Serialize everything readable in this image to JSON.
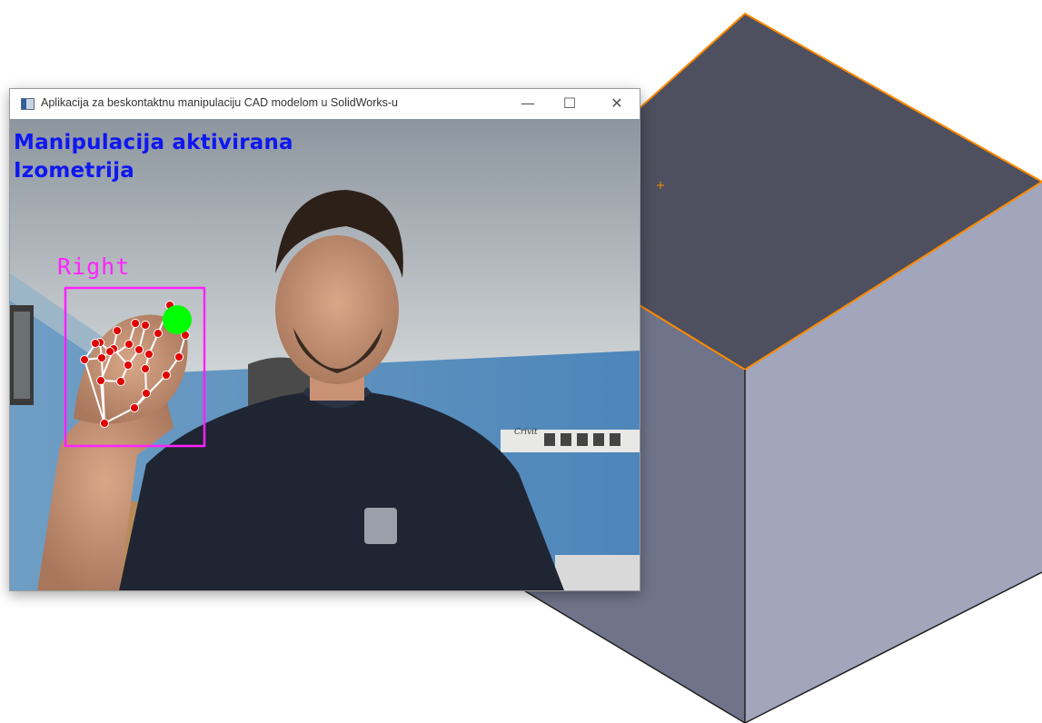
{
  "window": {
    "title": "Aplikacija za beskontaktnu manipulaciju CAD modelom u SolidWorks-u",
    "icon": "app-window-icon",
    "controls": {
      "minimize": "—",
      "maximize": "☐",
      "close": "✕"
    }
  },
  "camera_feed": {
    "status_line": "Manipulacija  aktivirana",
    "view_line": "Izometrija",
    "hand_label": "Right",
    "sign_text": "Crivit",
    "colors": {
      "status_text": "#0f17f0",
      "hand_box": "#ff22ff",
      "landmark": "#e00000",
      "pointer": "#00ff00",
      "skeleton": "#ffffff"
    }
  },
  "cad_view": {
    "colors": {
      "top_face": "#4e5060",
      "left_face": "#70748a",
      "right_face": "#a1a6bc",
      "edge_highlight": "#ff8a00"
    }
  }
}
